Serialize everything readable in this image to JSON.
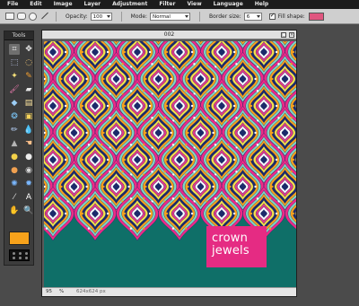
{
  "menu": [
    "File",
    "Edit",
    "Image",
    "Layer",
    "Adjustment",
    "Filter",
    "View",
    "Language",
    "Help"
  ],
  "options": {
    "opacity_label": "Opacity:",
    "opacity_value": "100",
    "mode_label": "Mode:",
    "mode_value": "Normal",
    "border_label": "Border size:",
    "border_value": "6",
    "fill_label": "Fill shape:",
    "fill_checked": true,
    "fill_color": "#e0567f"
  },
  "tools_panel": {
    "title": "Tools",
    "foreground_color": "#f7a21b",
    "tools": [
      {
        "name": "crop-icon",
        "glyph": "⌗",
        "color": "#f0f0f0",
        "active": true
      },
      {
        "name": "move-icon",
        "glyph": "✥",
        "color": "#f0f0f0"
      },
      {
        "name": "marquee-icon",
        "glyph": "⬚",
        "color": "#cfd8ff"
      },
      {
        "name": "lasso-icon",
        "glyph": "◌",
        "color": "#ffd27a"
      },
      {
        "name": "wand-icon",
        "glyph": "✦",
        "color": "#f6e07a"
      },
      {
        "name": "pencil-icon",
        "glyph": "✎",
        "color": "#f5a030"
      },
      {
        "name": "brush-icon",
        "glyph": "🖌",
        "color": "#f07bb0"
      },
      {
        "name": "eraser-icon",
        "glyph": "▰",
        "color": "#e8e8e8"
      },
      {
        "name": "fill-icon",
        "glyph": "◆",
        "color": "#9ccdf5"
      },
      {
        "name": "gradient-icon",
        "glyph": "▤",
        "color": "#ffe7a0"
      },
      {
        "name": "clone-icon",
        "glyph": "❂",
        "color": "#7ac4f5"
      },
      {
        "name": "replace-color-icon",
        "glyph": "▣",
        "color": "#f5d35a"
      },
      {
        "name": "drawing-icon",
        "glyph": "✏",
        "color": "#bbd6ff"
      },
      {
        "name": "blur-icon",
        "glyph": "💧",
        "color": "#66a8ff"
      },
      {
        "name": "sharpen-icon",
        "glyph": "▲",
        "color": "#b5b5b5"
      },
      {
        "name": "smudge-icon",
        "glyph": "☚",
        "color": "#ffc08a"
      },
      {
        "name": "sponge-icon",
        "glyph": "●",
        "color": "#f4d24a"
      },
      {
        "name": "dodge-icon",
        "glyph": "●",
        "color": "#eeeeee"
      },
      {
        "name": "burn-icon",
        "glyph": "●",
        "color": "#f0a050"
      },
      {
        "name": "red-eye-icon",
        "glyph": "◉",
        "color": "#d7d7d7"
      },
      {
        "name": "bloat-icon",
        "glyph": "✺",
        "color": "#7ab7ff"
      },
      {
        "name": "pinch-icon",
        "glyph": "✹",
        "color": "#7ab7ff"
      },
      {
        "name": "color-picker-icon",
        "glyph": "⁄",
        "color": "#dddddd"
      },
      {
        "name": "type-icon",
        "glyph": "A",
        "color": "#ffffff"
      },
      {
        "name": "hand-icon",
        "glyph": "✋",
        "color": "#f5c08a"
      },
      {
        "name": "zoom-icon",
        "glyph": "🔍",
        "color": "#e0e0e0"
      }
    ]
  },
  "document": {
    "title": "002",
    "overlay_text": "crown jewels",
    "overlay_color": "#e52b83",
    "zoom_value": "95",
    "zoom_unit": "%",
    "dimensions": "624x624 px"
  }
}
